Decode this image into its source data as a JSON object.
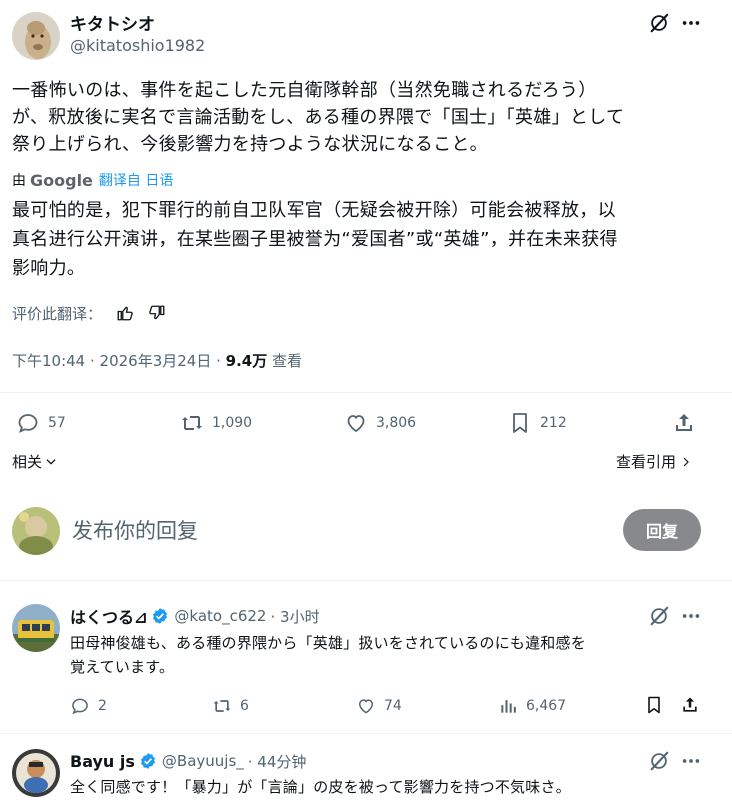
{
  "post": {
    "author_name": "キタトシオ",
    "author_handle": "@kitatoshio1982",
    "text_line1": "一番怖いのは、事件を起こした元自衛隊幹部（当然免職されるだろう）",
    "text_line2": "が、釈放後に実名で言論活動をし、ある種の界隈で「国士」「英雄」として",
    "text_line3": "祭り上げられ、今後影響力を持つような状況になること。",
    "translate_by": "由",
    "translate_google": "Google",
    "translate_from": "翻译自 日语",
    "translated_line1": "最可怕的是，犯下罪行的前自卫队军官（无疑会被开除）可能会被释放，以",
    "translated_line2": "真名进行公开演讲，在某些圈子里被誉为“爱国者”或“英雄”，并在未来获得",
    "translated_line3": "影响力。",
    "rate_label": "评价此翻译：",
    "time": "下午10:44 · 2026年3月24日 · ",
    "views_count": "9.4万",
    "views_label": " 查看",
    "replies": "57",
    "retweets": "1,090",
    "likes": "3,806",
    "bookmarks": "212",
    "related_label": "相关",
    "quotes_label": "查看引用"
  },
  "compose": {
    "placeholder": "发布你的回复",
    "button": "回复"
  },
  "replies": [
    {
      "name": "はくつる⊿",
      "handle": "@kato_c622",
      "time": "· 3小时",
      "text_line1": "田母神俊雄も、ある種の界隈から「英雄」扱いをされているのにも違和感を",
      "text_line2": "覚えています。",
      "replies": "2",
      "retweets": "6",
      "likes": "74",
      "views": "6,467"
    },
    {
      "name": "Bayu js",
      "handle": "@Bayuujs_",
      "time": "· 44分钟",
      "text_line1": "全く同感です！「暴力」が「言論」の皮を被って影響力を持つ不気味さ。"
    }
  ],
  "colors": {
    "text": "#0f1419",
    "muted": "#536471",
    "verified": "#1d9bf0",
    "reply_button": "#87898c"
  }
}
